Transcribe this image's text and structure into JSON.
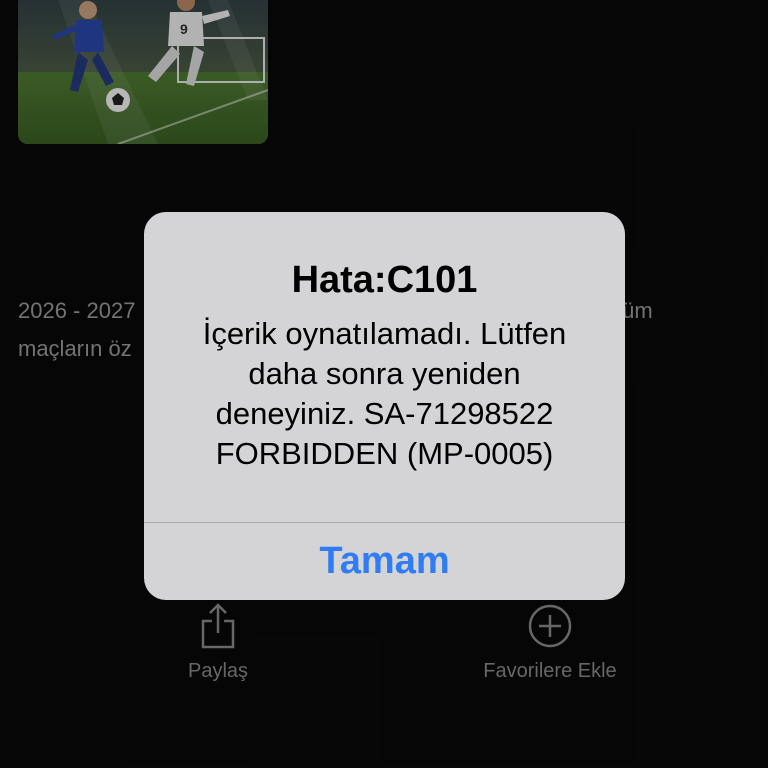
{
  "background": {
    "description_left_line1": "2026 - 2027",
    "description_right_line1": "tüm",
    "description_left_line2": "maçların öz",
    "actions": [
      {
        "label": "Paylaş",
        "icon": "share-icon"
      },
      {
        "label": "Favorilere Ekle",
        "icon": "add-circle-icon"
      }
    ]
  },
  "alert": {
    "title": "Hata:C101",
    "message": "İçerik oynatılamadı. Lütfen\ndaha sonra yeniden\ndeneyiniz. SA-71298522\nFORBIDDEN (MP-0005)",
    "button_label": "Tamam",
    "button_color": "#2f7cf6"
  }
}
